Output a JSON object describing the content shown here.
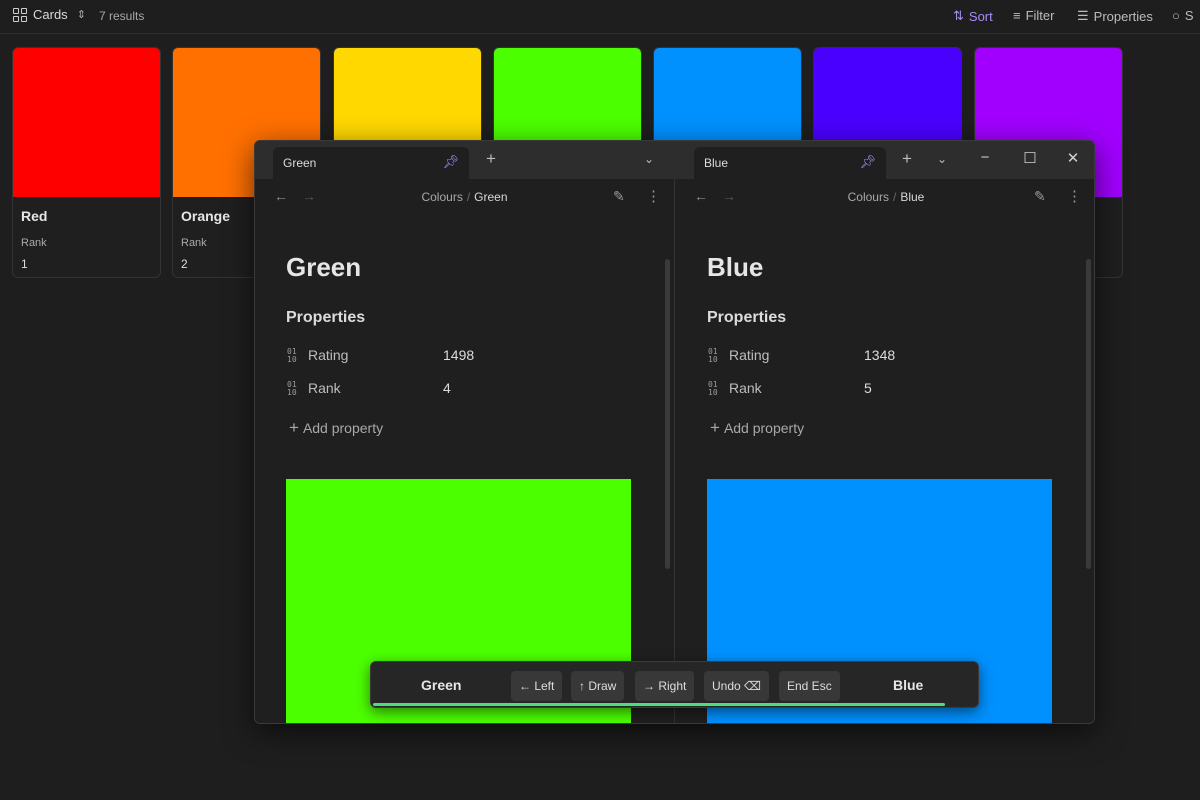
{
  "toolbar": {
    "view_label": "Cards",
    "results": "7 results",
    "sort_label": "Sort",
    "filter_label": "Filter",
    "properties_label": "Properties",
    "search_partial": "S"
  },
  "cards": [
    {
      "title": "Red",
      "label": "Rank",
      "value": "1",
      "color": "#ff0000"
    },
    {
      "title": "Orange",
      "label": "Rank",
      "value": "2",
      "color": "#ff7000"
    },
    {
      "title": "",
      "label": "",
      "value": "",
      "color": "#ffd800"
    },
    {
      "title": "",
      "label": "",
      "value": "",
      "color": "#4cff00"
    },
    {
      "title": "",
      "label": "",
      "value": "",
      "color": "#0091ff"
    },
    {
      "title": "",
      "label": "",
      "value": "",
      "color": "#4a00ff"
    },
    {
      "title": "",
      "label": "",
      "value": "",
      "color": "#a100ff"
    }
  ],
  "window": {
    "left_tab": "Green",
    "right_tab": "Blue",
    "left": {
      "breadcrumb_parent": "Colours",
      "breadcrumb_current": "Green",
      "title": "Green",
      "properties_heading": "Properties",
      "properties": [
        {
          "name": "Rating",
          "value": "1498"
        },
        {
          "name": "Rank",
          "value": "4"
        }
      ],
      "add_property": "Add property",
      "swatch_color": "#4cff00"
    },
    "right": {
      "breadcrumb_parent": "Colours",
      "breadcrumb_current": "Blue",
      "title": "Blue",
      "properties_heading": "Properties",
      "properties": [
        {
          "name": "Rating",
          "value": "1348"
        },
        {
          "name": "Rank",
          "value": "5"
        }
      ],
      "add_property": "Add property",
      "swatch_color": "#0091ff"
    }
  },
  "comparison": {
    "left_name": "Green",
    "right_name": "Blue",
    "buttons": {
      "left": "← Left",
      "draw": "↑ Draw",
      "right": "→ Right",
      "undo": "Undo ⌫",
      "end": "End Esc"
    },
    "progress": 0.94,
    "progress_color": "#4ade80"
  },
  "colors": {
    "accent": "#a88bfa",
    "background": "#1e1e1e"
  }
}
